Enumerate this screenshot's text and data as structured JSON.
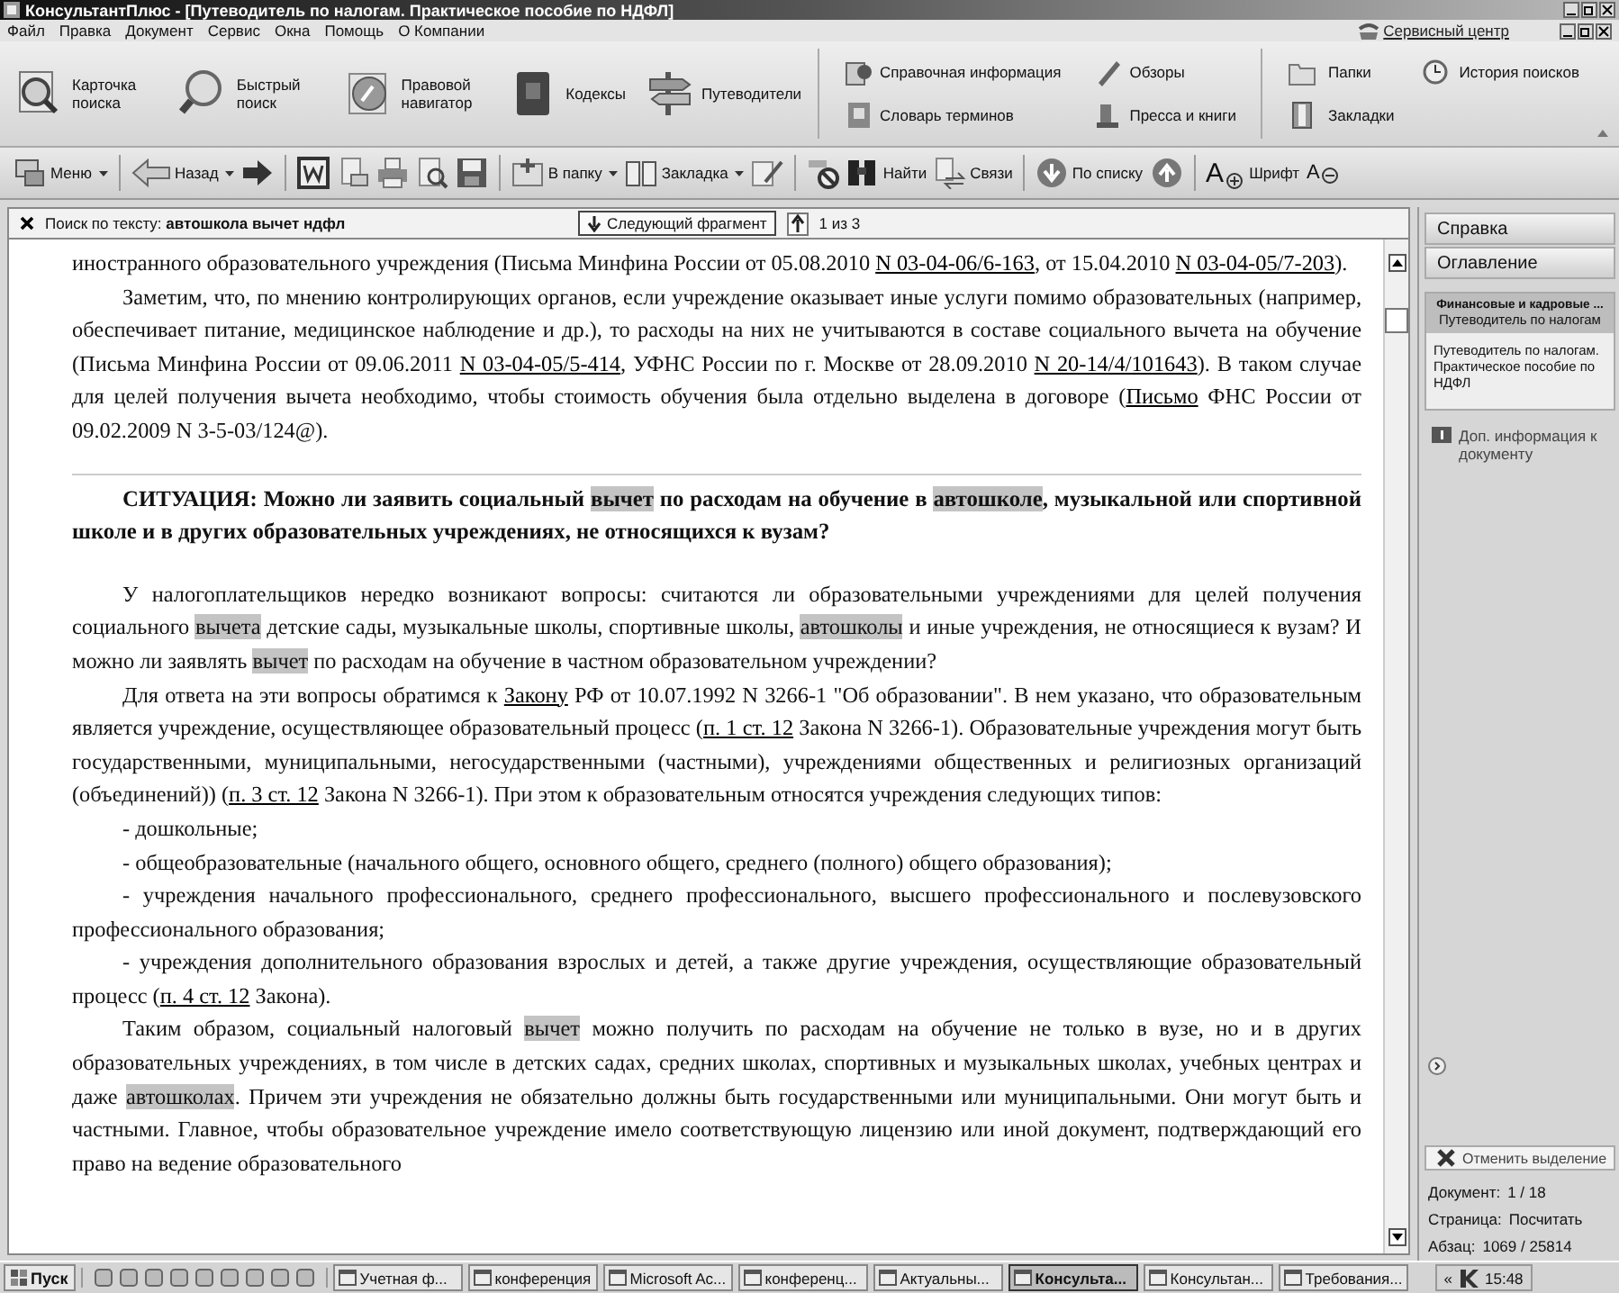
{
  "window": {
    "title": "КонсультантПлюс - [Путеводитель по налогам. Практическое пособие по НДФЛ]"
  },
  "menu": {
    "items": [
      "Файл",
      "Правка",
      "Документ",
      "Сервис",
      "Окна",
      "Помощь",
      "О Компании"
    ],
    "service_center": "Сервисный центр"
  },
  "ribbon": {
    "main": [
      "Карточка поиска",
      "Быстрый поиск",
      "Правовой навигатор",
      "Кодексы",
      "Путеводители"
    ],
    "info": [
      "Справочная информация",
      "Обзоры",
      "Словарь терминов",
      "Пресса и книги"
    ],
    "folders": [
      "Папки",
      "История поисков",
      "Закладки"
    ]
  },
  "toolbar": {
    "menu": "Меню",
    "back": "Назад",
    "to_folder": "В папку",
    "bookmark": "Закладка",
    "find": "Найти",
    "links": "Связи",
    "by_list": "По списку",
    "font_up": "A",
    "font": "Шрифт",
    "font_down": "A"
  },
  "search_bar": {
    "query": "Поиск по тексту: **автошкола вычет ндфл**",
    "next_button": "Следующий фрагмент",
    "counter": "1 из 3"
  },
  "document": {
    "blocks": [
      {
        "kind": "continued",
        "segments": [
          {
            "kind": "plain",
            "text": "иностранного образовательного учреждения (Письма Минфина России от 05.08.2010 "
          },
          {
            "kind": "link",
            "text": "N 03-04-06/6-163"
          },
          {
            "kind": "plain",
            "text": ", от 15.04.2010 "
          },
          {
            "kind": "link",
            "text": "N 03-04-05/7-203"
          },
          {
            "kind": "plain",
            "text": ")."
          }
        ]
      },
      {
        "kind": "paragraph",
        "segments": [
          {
            "kind": "plain",
            "text": "Заметим, что, по мнению контролирующих органов, если учреждение оказывает иные услуги помимо образовательных (например, обеспечивает питание, медицинское наблюдение и др.), то расходы на них не учитываются в составе социального вычета на обучение (Письма Минфина России от 09.06.2011 "
          },
          {
            "kind": "link",
            "text": "N 03-04-05/5-414"
          },
          {
            "kind": "plain",
            "text": ", УФНС России по г. Москве от 28.09.2010 "
          },
          {
            "kind": "link",
            "text": "N 20-14/4/101643"
          },
          {
            "kind": "plain",
            "text": "). В таком случае для целей получения вычета необходимо, чтобы стоимость обучения была отдельно выделена в договоре ("
          },
          {
            "kind": "link",
            "text": "Письмо"
          },
          {
            "kind": "plain",
            "text": " ФНС России от 09.02.2009 N 3-5-03/124@)."
          }
        ]
      },
      {
        "kind": "heading",
        "segments": [
          {
            "kind": "plain",
            "text": "СИТУАЦИЯ: Можно ли заявить социальный "
          },
          {
            "kind": "hit",
            "text": "вычет"
          },
          {
            "kind": "plain",
            "text": " по расходам на обучение в "
          },
          {
            "kind": "hit",
            "text": "автошколе"
          },
          {
            "kind": "plain",
            "text": ", музыкальной или спортивной школе и в других образовательных учреждениях, не относящихся к вузам?"
          }
        ]
      },
      {
        "kind": "paragraph",
        "segments": [
          {
            "kind": "plain",
            "text": "У налогоплательщиков нередко возникают вопросы: считаются ли образовательными учреждениями для целей получения социального "
          },
          {
            "kind": "hit",
            "text": "вычета"
          },
          {
            "kind": "plain",
            "text": " детские сады, музыкальные школы, спортивные школы, "
          },
          {
            "kind": "hit",
            "text": "автошколы"
          },
          {
            "kind": "plain",
            "text": " и иные учреждения, не относящиеся к вузам? И можно ли заявлять "
          },
          {
            "kind": "hit",
            "text": "вычет"
          },
          {
            "kind": "plain",
            "text": " по расходам на обучение в частном образовательном учреждении?"
          }
        ]
      },
      {
        "kind": "paragraph",
        "segments": [
          {
            "kind": "plain",
            "text": "Для ответа на эти вопросы обратимся к "
          },
          {
            "kind": "link",
            "text": "Закону"
          },
          {
            "kind": "plain",
            "text": " РФ от 10.07.1992 N 3266-1 \"Об образовании\". В нем указано, что образовательным является учреждение, осуществляющее образовательный процесс ("
          },
          {
            "kind": "link",
            "text": "п. 1 ст. 12"
          },
          {
            "kind": "plain",
            "text": " Закона N 3266-1). Образовательные учреждения могут быть государственными, муниципальными, негосударственными (частными), учреждениями общественных и религиозных организаций (объединений)) ("
          },
          {
            "kind": "link",
            "text": "п. 3 ст. 12"
          },
          {
            "kind": "plain",
            "text": " Закона N 3266-1). При этом к образовательным относятся учреждения следующих типов:"
          }
        ]
      },
      {
        "kind": "paragraph",
        "segments": [
          {
            "kind": "plain",
            "text": "- дошкольные;"
          }
        ]
      },
      {
        "kind": "paragraph",
        "segments": [
          {
            "kind": "plain",
            "text": "- общеобразовательные (начального общего, основного общего, среднего (полного) общего образования);"
          }
        ]
      },
      {
        "kind": "paragraph",
        "segments": [
          {
            "kind": "plain",
            "text": "- учреждения начального профессионального, среднего профессионального, высшего профессионального и послевузовского профессионального образования;"
          }
        ]
      },
      {
        "kind": "paragraph",
        "segments": [
          {
            "kind": "plain",
            "text": "- учреждения дополнительного образования взрослых и детей, а также другие учреждения, осуществляющие образовательный процесс ("
          },
          {
            "kind": "link",
            "text": "п. 4 ст. 12"
          },
          {
            "kind": "plain",
            "text": " Закона)."
          }
        ]
      },
      {
        "kind": "paragraph",
        "segments": [
          {
            "kind": "plain",
            "text": "Таким образом, социальный налоговый "
          },
          {
            "kind": "hit",
            "text": "вычет"
          },
          {
            "kind": "plain",
            "text": " можно получить по расходам на обучение не только в вузе, но и в других образовательных учреждениях, в том числе в детских садах, средних школах, спортивных и музыкальных школах, учебных центрах и даже "
          },
          {
            "kind": "hit",
            "text": "автошколах"
          },
          {
            "kind": "plain",
            "text": ". Причем эти учреждения не обязательно должны быть государственными или муниципальными. Они могут быть и частными. Главное, чтобы образовательное учреждение имело соответствующую лицензию или иной документ, подтверждающий его право на ведение образовательного"
          }
        ]
      }
    ]
  },
  "side_panel": {
    "tabs": [
      {
        "label": "Справка"
      },
      {
        "label": "Оглавление"
      }
    ],
    "card": {
      "title": "Финансовые и кадровые ...",
      "subtitle": "Путеводитель по налогам",
      "body": "Путеводитель по налогам. Практическое пособие по НДФЛ"
    },
    "extra_info": "Доп. информация к документу",
    "clear_button": "Отменить выделение",
    "stats": [
      {
        "label": "Документ:",
        "value": "1 / 18"
      },
      {
        "label": "Страница:",
        "value": "Посчитать"
      },
      {
        "label": "Абзац:",
        "value": "1069 / 25814"
      }
    ]
  },
  "taskbar": {
    "start": "Пуск",
    "tasks": [
      {
        "label": "Учетная ф...",
        "selected": false
      },
      {
        "label": "конференция",
        "selected": false
      },
      {
        "label": "Microsoft Ac...",
        "selected": false
      },
      {
        "label": "конференц...",
        "selected": false
      },
      {
        "label": "Актуальны...",
        "selected": false
      },
      {
        "label": "Консульта...",
        "selected": true
      },
      {
        "label": "Консультан...",
        "selected": false
      },
      {
        "label": "Требования...",
        "selected": false
      }
    ],
    "tray_expand": "«",
    "clock": "15:48"
  }
}
